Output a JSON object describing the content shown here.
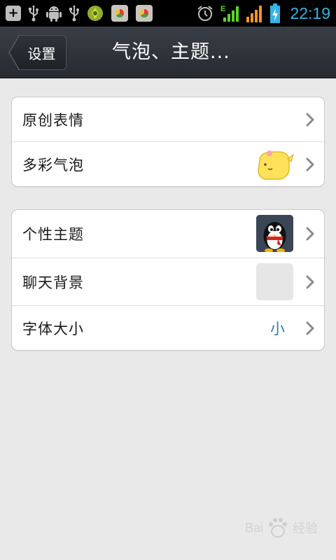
{
  "status_bar": {
    "time": "22:19",
    "left_icons": [
      "add-notification-icon",
      "usb-icon",
      "android-debug-icon",
      "usb-icon",
      "app-notification-icon",
      "chrome-store-icon",
      "chrome-store-icon"
    ],
    "right_icons": [
      "alarm-icon",
      "edge-signal-icon",
      "signal-icon",
      "battery-charging-icon"
    ],
    "network_label": "E"
  },
  "title_bar": {
    "back_label": "设置",
    "title": "气泡、主题..."
  },
  "groups": [
    {
      "rows": [
        {
          "label": "原创表情"
        },
        {
          "label": "多彩气泡",
          "thumbnail": "yellow-bubble-icon"
        }
      ]
    },
    {
      "rows": [
        {
          "label": "个性主题",
          "thumbnail": "qq-penguin-icon"
        },
        {
          "label": "聊天背景",
          "thumbnail": "blank-background-thumbnail"
        },
        {
          "label": "字体大小",
          "value": "小"
        }
      ]
    }
  ],
  "watermark": {
    "text": "Bai",
    "text2": "经验"
  },
  "colors": {
    "status_time": "#33b5e5",
    "value_blue": "#2f78b8",
    "title_bar_bg": "#2d3137",
    "page_bg": "#e9e9e9"
  }
}
